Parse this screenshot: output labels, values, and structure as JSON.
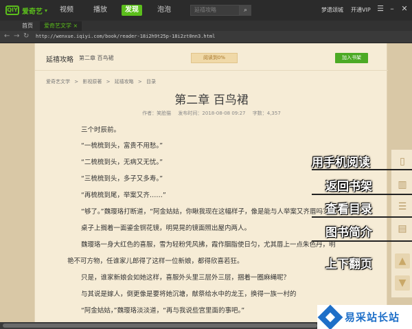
{
  "app": {
    "logo_text": "爱奇艺",
    "nav": [
      "视频",
      "播放",
      "发现",
      "泡泡"
    ],
    "active_nav": "发现",
    "search_placeholder": "延禧攻略",
    "user": "梦遗颂城",
    "vip": "开通VIP"
  },
  "tabs": [
    "首页",
    "爱奇艺文学 ×"
  ],
  "address": {
    "url": "http://wenxue.iqiyi.com/book/reader-18i2h9t25p-18i2zt0nn3.html"
  },
  "book": {
    "name": "延禧攻略",
    "chapter": "第二章 百鸟裙",
    "progress": "阅读到0%",
    "add_shelf": "加入书架"
  },
  "breadcrumb": [
    "爱奇艺文学",
    ">",
    "影视原著",
    ">",
    "延禧攻略",
    ">",
    "目录"
  ],
  "chapter": {
    "title": "第二章  百鸟裙",
    "author": "作者：笑脸猫",
    "time": "发布时间：2018-08-08 09:27",
    "words": "字数：4,357"
  },
  "paragraphs": [
    "三个时辰前。",
    "“一梳梳到头，富贵不用愁。”",
    "“二梳梳到头，无病又无忧。”",
    "“三梳梳到头，多子又多寿。”",
    "“再梳梳到尾，举案又齐……”",
    "“够了。”魏璎珞打断道，“阿金姑姑，你瞅我现在这幅样子，像是能与人举案又齐眉吗？”",
    "桌子上搁着一面鎏金铜花镜，明晃晃的镜面照出屋内两人。",
    "魏璎珞一身大红色的喜服，雪为轻粉凭风拂，霞作胭脂使日匀，尤其唇上一点朱色丹，明",
    "艳不可方物，任谁家儿郎得了这样一位新娘，都得欣喜若狂。",
    "只是，谁家新娘会如她这样，喜服外头里三层外三层，捆着一圈麻绳呢？",
    "与其说是嫁人，倒更像是要将她沉塘，献祭给水中的龙王，换得一族一村的",
    "“阿金姑姑，”魏璎珞淡淡道，“再与我说些宫里面的事吧。”"
  ],
  "sidebar": {
    "icons": [
      "phone-icon",
      "bookshelf-icon",
      "list-icon",
      "book-icon",
      "arrow-up-icon",
      "arrow-down-icon"
    ]
  },
  "annotations": [
    "用手机阅读",
    "返回书架",
    "查看目录",
    "图书简介",
    "上下翻页"
  ],
  "watermark": "易采站长站"
}
